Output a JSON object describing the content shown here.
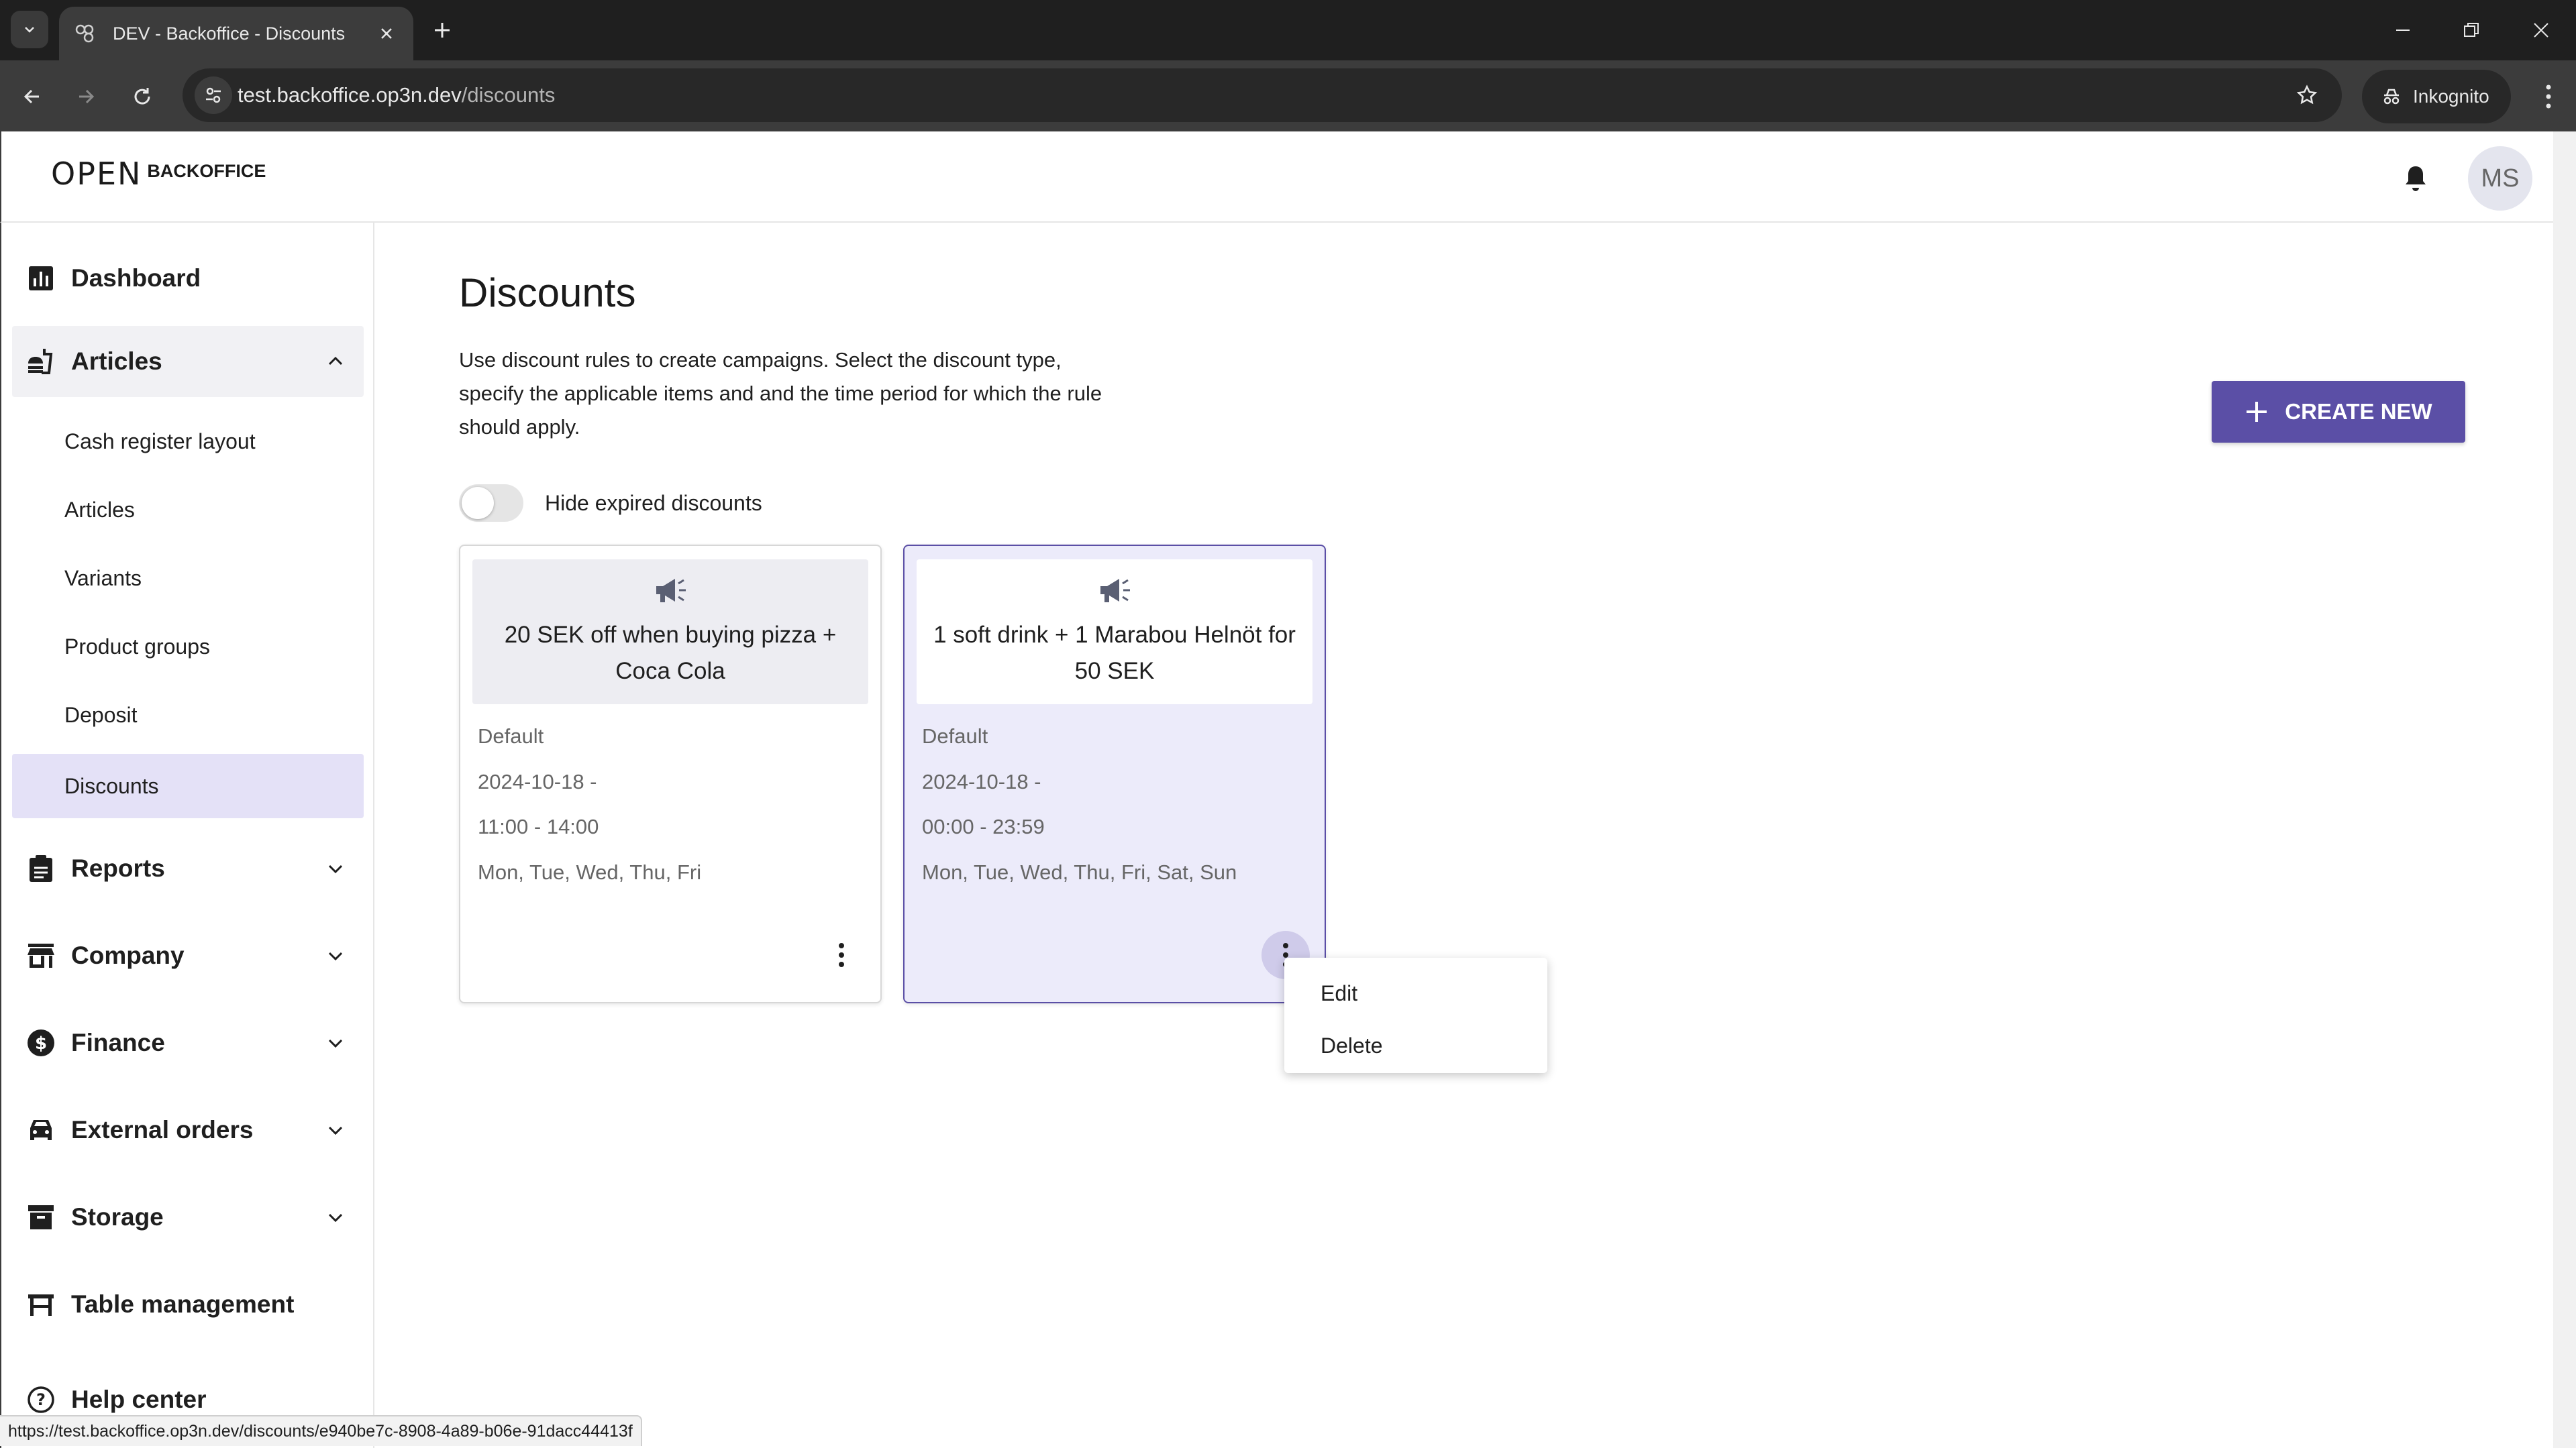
{
  "browser": {
    "tab_title": "DEV - Backoffice - Discounts",
    "url_host": "test.backoffice.op3n.dev",
    "url_path": "/discounts",
    "incognito_label": "Inkognito",
    "status_url": "https://test.backoffice.op3n.dev/discounts/e940be7c-8908-4a89-b06e-91dacc44413f"
  },
  "header": {
    "logo_mark": "OPEN",
    "logo_text": "BACKOFFICE",
    "avatar_initials": "MS"
  },
  "sidebar": {
    "dashboard": "Dashboard",
    "articles": "Articles",
    "articles_sub": [
      "Cash register layout",
      "Articles",
      "Variants",
      "Product groups",
      "Deposit",
      "Discounts"
    ],
    "reports": "Reports",
    "company": "Company",
    "finance": "Finance",
    "external_orders": "External orders",
    "storage": "Storage",
    "table_management": "Table management",
    "help_center": "Help center"
  },
  "main": {
    "title": "Discounts",
    "description": "Use discount rules to create campaigns. Select the discount type, specify the applicable items and and the time period for which the rule should apply.",
    "create_button": "CREATE NEW",
    "toggle_label": "Hide expired discounts",
    "toggle_on": false,
    "cards": [
      {
        "title": "20 SEK off when buying pizza + Coca Cola",
        "type": "Default",
        "date": "2024-10-18 -",
        "time": "11:00 - 14:00",
        "days": "Mon, Tue, Wed, Thu, Fri"
      },
      {
        "title": "1 soft drink + 1 Marabou Helnöt for 50 SEK",
        "type": "Default",
        "date": "2024-10-18 -",
        "time": "00:00 - 23:59",
        "days": "Mon, Tue, Wed, Thu, Fri, Sat, Sun"
      }
    ],
    "context_menu": [
      "Edit",
      "Delete"
    ]
  },
  "colors": {
    "accent": "#5b4fa6",
    "selected_card_bg": "#ecebfa",
    "active_nav_bg": "#e4e1f7"
  }
}
